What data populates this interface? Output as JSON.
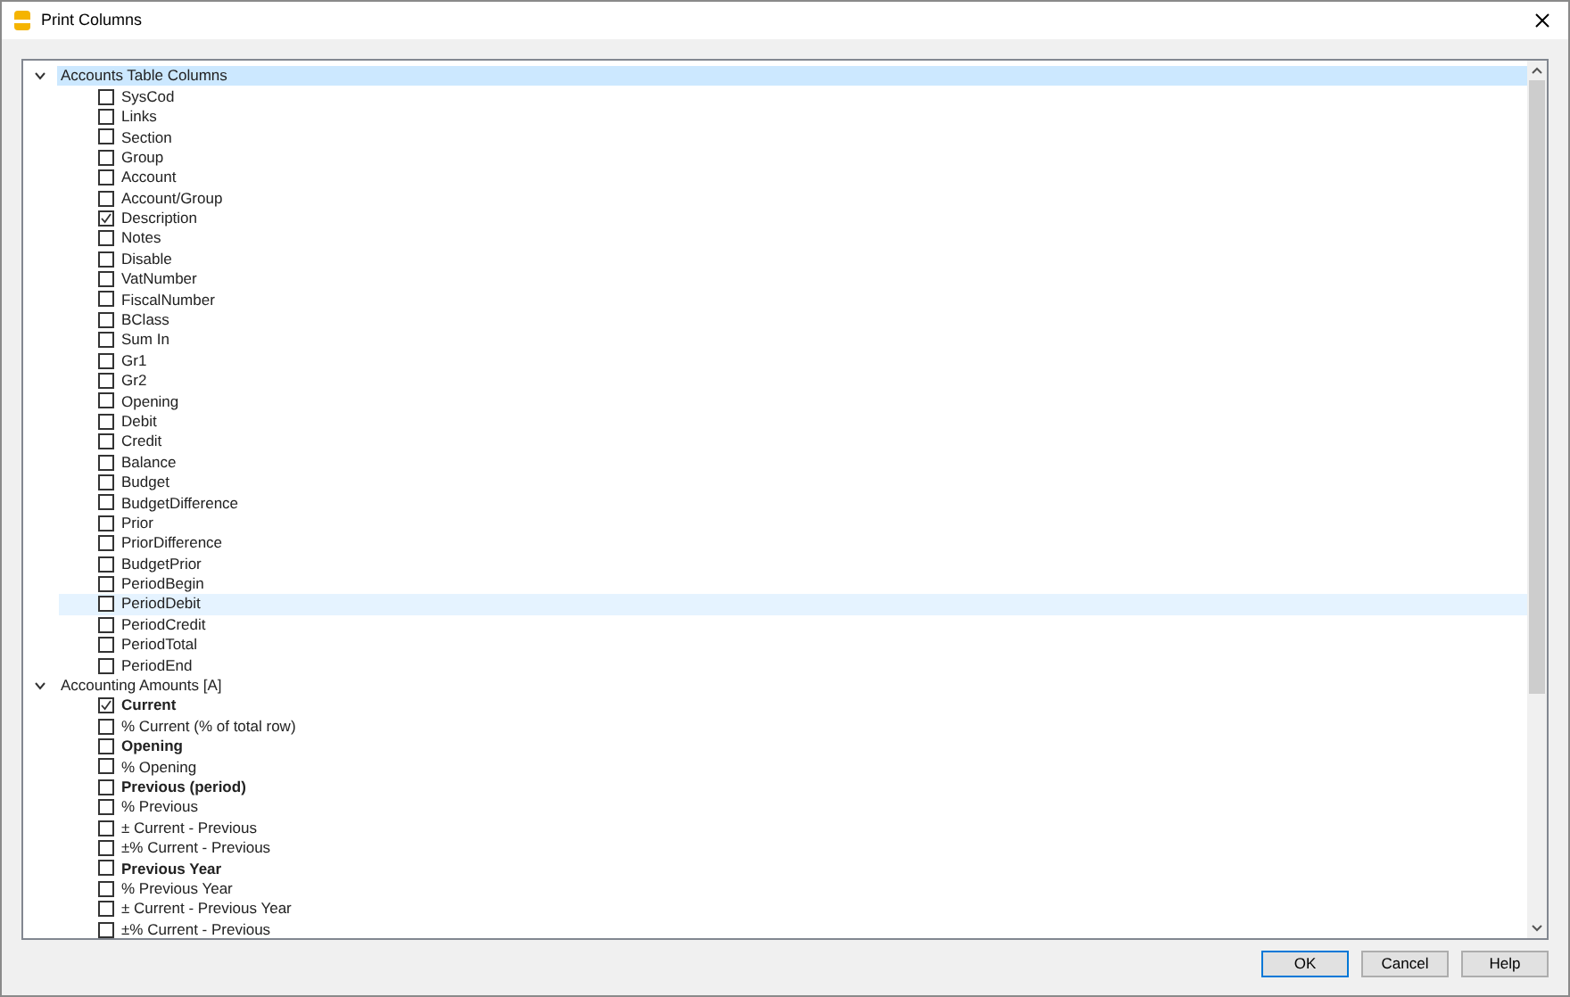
{
  "window": {
    "title": "Print Columns"
  },
  "tree": [
    {
      "label": "Accounts Table Columns",
      "expanded": true,
      "selected": true,
      "children": [
        {
          "label": "SysCod",
          "checked": false,
          "bold": false,
          "selected": false
        },
        {
          "label": "Links",
          "checked": false,
          "bold": false,
          "selected": false
        },
        {
          "label": "Section",
          "checked": false,
          "bold": false,
          "selected": false
        },
        {
          "label": "Group",
          "checked": false,
          "bold": false,
          "selected": false
        },
        {
          "label": "Account",
          "checked": false,
          "bold": false,
          "selected": false
        },
        {
          "label": "Account/Group",
          "checked": false,
          "bold": false,
          "selected": false
        },
        {
          "label": "Description",
          "checked": true,
          "bold": false,
          "selected": false
        },
        {
          "label": "Notes",
          "checked": false,
          "bold": false,
          "selected": false
        },
        {
          "label": "Disable",
          "checked": false,
          "bold": false,
          "selected": false
        },
        {
          "label": "VatNumber",
          "checked": false,
          "bold": false,
          "selected": false
        },
        {
          "label": "FiscalNumber",
          "checked": false,
          "bold": false,
          "selected": false
        },
        {
          "label": "BClass",
          "checked": false,
          "bold": false,
          "selected": false
        },
        {
          "label": "Sum In",
          "checked": false,
          "bold": false,
          "selected": false
        },
        {
          "label": "Gr1",
          "checked": false,
          "bold": false,
          "selected": false
        },
        {
          "label": "Gr2",
          "checked": false,
          "bold": false,
          "selected": false
        },
        {
          "label": "Opening",
          "checked": false,
          "bold": false,
          "selected": false
        },
        {
          "label": "Debit",
          "checked": false,
          "bold": false,
          "selected": false
        },
        {
          "label": "Credit",
          "checked": false,
          "bold": false,
          "selected": false
        },
        {
          "label": "Balance",
          "checked": false,
          "bold": false,
          "selected": false
        },
        {
          "label": "Budget",
          "checked": false,
          "bold": false,
          "selected": false
        },
        {
          "label": "BudgetDifference",
          "checked": false,
          "bold": false,
          "selected": false
        },
        {
          "label": "Prior",
          "checked": false,
          "bold": false,
          "selected": false
        },
        {
          "label": "PriorDifference",
          "checked": false,
          "bold": false,
          "selected": false
        },
        {
          "label": "BudgetPrior",
          "checked": false,
          "bold": false,
          "selected": false
        },
        {
          "label": "PeriodBegin",
          "checked": false,
          "bold": false,
          "selected": false
        },
        {
          "label": "PeriodDebit",
          "checked": false,
          "bold": false,
          "selected": true
        },
        {
          "label": "PeriodCredit",
          "checked": false,
          "bold": false,
          "selected": false
        },
        {
          "label": "PeriodTotal",
          "checked": false,
          "bold": false,
          "selected": false
        },
        {
          "label": "PeriodEnd",
          "checked": false,
          "bold": false,
          "selected": false
        }
      ]
    },
    {
      "label": "Accounting Amounts [A]",
      "expanded": true,
      "selected": false,
      "children": [
        {
          "label": "Current",
          "checked": true,
          "bold": true,
          "selected": false
        },
        {
          "label": "% Current (% of total row)",
          "checked": false,
          "bold": false,
          "selected": false
        },
        {
          "label": "Opening",
          "checked": false,
          "bold": true,
          "selected": false
        },
        {
          "label": "% Opening",
          "checked": false,
          "bold": false,
          "selected": false
        },
        {
          "label": "Previous (period)",
          "checked": false,
          "bold": true,
          "selected": false
        },
        {
          "label": "% Previous",
          "checked": false,
          "bold": false,
          "selected": false
        },
        {
          "label": "± Current - Previous",
          "checked": false,
          "bold": false,
          "selected": false
        },
        {
          "label": "±% Current - Previous",
          "checked": false,
          "bold": false,
          "selected": false
        },
        {
          "label": "Previous Year",
          "checked": false,
          "bold": true,
          "selected": false
        },
        {
          "label": "% Previous Year",
          "checked": false,
          "bold": false,
          "selected": false
        },
        {
          "label": "± Current - Previous Year",
          "checked": false,
          "bold": false,
          "selected": false
        },
        {
          "label": "±% Current - Previous",
          "checked": false,
          "bold": false,
          "selected": false
        }
      ]
    }
  ],
  "buttons": [
    {
      "label": "OK",
      "default": true
    },
    {
      "label": "Cancel",
      "default": false
    },
    {
      "label": "Help",
      "default": false
    }
  ]
}
